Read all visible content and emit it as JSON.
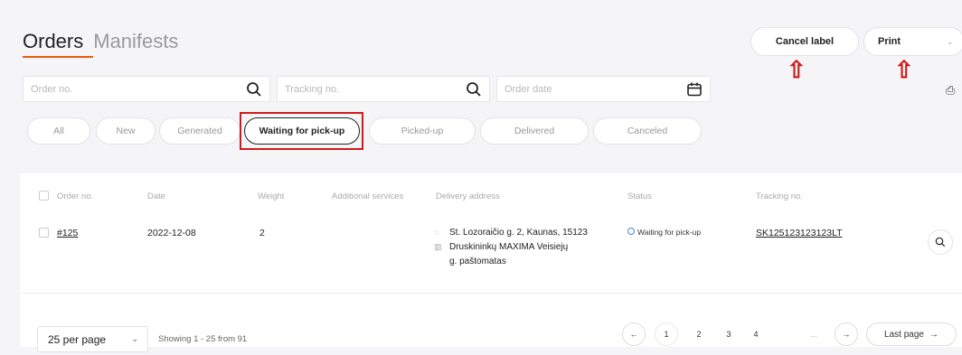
{
  "tabs": {
    "orders": "Orders",
    "manifests": "Manifests"
  },
  "toolbar": {
    "cancel_label": "Cancel label",
    "print": "Print"
  },
  "search": {
    "order_no": "Order no.",
    "tracking_no": "Tracking no.",
    "order_date": "Order date"
  },
  "filters": [
    "All",
    "New",
    "Generated",
    "Waiting for pick-up",
    "Picked-up",
    "Delivered",
    "Canceled"
  ],
  "table": {
    "headers": [
      "Order no.",
      "Date",
      "Weight",
      "Additional services",
      "Delivery address",
      "Status",
      "Tracking no."
    ],
    "row": {
      "order_no": "#125",
      "date": "2022-12-08",
      "weight": "2",
      "address_line1": "St. Lozoraičio g. 2, Kaunas, 15123",
      "address_line2": "Druskininkų MAXIMA Veisiejų",
      "address_line3": "g. paštomatas",
      "status": "Waiting for pick-up",
      "tracking": "SK125123123123LT"
    }
  },
  "pagination": {
    "per_page": "25 per page",
    "showing": "Showing 1 - 25 from 91",
    "pages": [
      "1",
      "2",
      "3",
      "4",
      "..."
    ],
    "last": "Last page"
  },
  "colors": {
    "accent": "#e8590c",
    "highlight": "#d21a1a",
    "status": "#4a7fd8"
  }
}
